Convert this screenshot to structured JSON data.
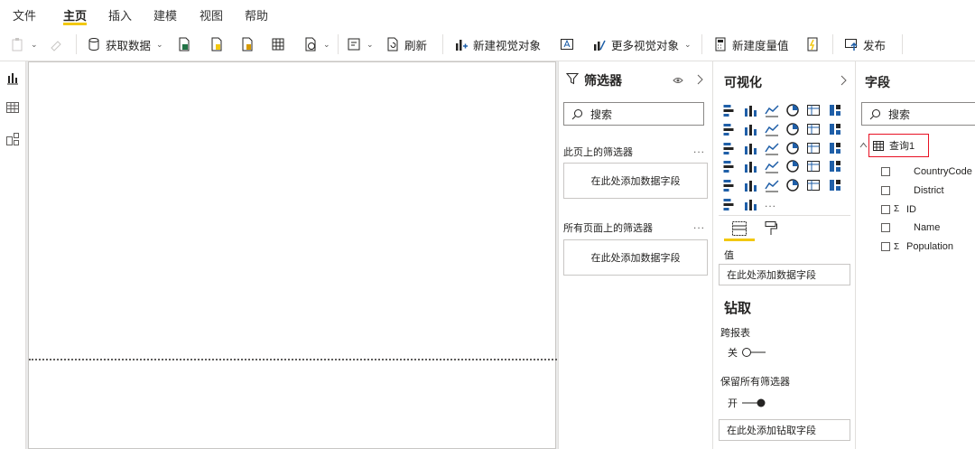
{
  "menu": {
    "items": [
      "文件",
      "主页",
      "插入",
      "建模",
      "视图",
      "帮助"
    ],
    "active_index": 1
  },
  "ribbon": {
    "get_data": "获取数据",
    "refresh": "刷新",
    "new_visual": "新建视觉对象",
    "more_visuals": "更多视觉对象",
    "new_measure": "新建度量值",
    "publish": "发布"
  },
  "filters": {
    "title": "筛选器",
    "search_placeholder": "搜索",
    "page_filters_label": "此页上的筛选器",
    "all_pages_label": "所有页面上的筛选器",
    "add_field": "在此处添加数据字段",
    "more": "..."
  },
  "visualizations": {
    "title": "可视化",
    "more": "...",
    "values_label": "值",
    "add_field": "在此处添加数据字段",
    "drill_title": "钻取",
    "cross_report_label": "跨报表",
    "cross_report_state": "关",
    "keep_filters_label": "保留所有筛选器",
    "keep_filters_state": "开",
    "add_drill_field": "在此处添加钻取字段"
  },
  "fields": {
    "title": "字段",
    "search_placeholder": "搜索",
    "table_name": "查询1",
    "columns": [
      {
        "name": "CountryCode",
        "sigma": false
      },
      {
        "name": "District",
        "sigma": false
      },
      {
        "name": "ID",
        "sigma": true
      },
      {
        "name": "Name",
        "sigma": false
      },
      {
        "name": "Population",
        "sigma": true
      }
    ]
  },
  "colors": {
    "accent_yellow": "#f2c811",
    "highlight_red": "#e81123",
    "visual_blue": "#1f5fa8",
    "excel_green": "#217346"
  },
  "sigma_symbol": "Σ"
}
